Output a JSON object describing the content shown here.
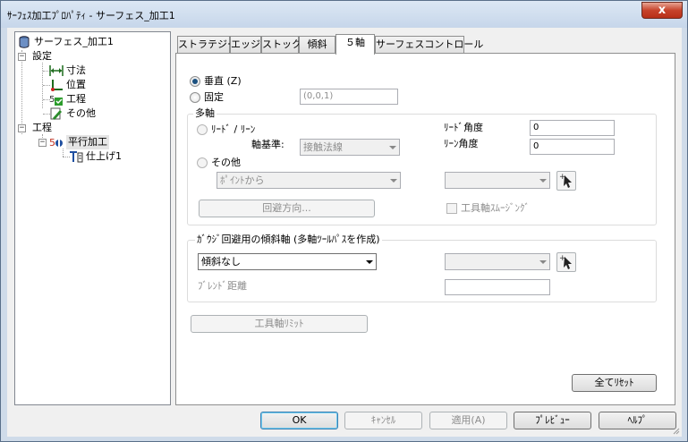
{
  "window": {
    "title": "ｻｰﾌｪｽ加工ﾌﾟﾛﾊﾟﾃｨ - サーフェス_加工1",
    "close_label": "x"
  },
  "tree": {
    "root": "サーフェス_加工1",
    "settings": "設定",
    "settings_items": [
      "寸法",
      "位置",
      "工程",
      "その他"
    ],
    "process": "工程",
    "parallel": "平行加工",
    "finish": "仕上げ1"
  },
  "tabs": [
    "ストラテジー",
    "エッジ",
    "ストック",
    "傾斜",
    "５軸",
    "サーフェスコントロール"
  ],
  "five_axis": {
    "vertical_label": "垂直 (Z)",
    "fixed_label": "固定",
    "fixed_value": "(0,0,1)",
    "multi_axis": {
      "title": "多軸",
      "lead_lean_label": "ﾘｰﾄﾞ / ﾘｰﾝ",
      "axis_ref_label": "軸基準:",
      "axis_ref_value": "接触法線",
      "lead_angle_label": "ﾘｰﾄﾞ角度",
      "lead_angle_value": "0",
      "lean_angle_label": "ﾘｰﾝ角度",
      "lean_angle_value": "0",
      "other_label": "その他",
      "point_from_value": "ﾎﾟｲﾝﾄから",
      "avoid_dir_button": "回避方向...",
      "tool_axis_smoothing_label": "工具軸ｽﾑｰｼﾞﾝｸﾞ"
    },
    "gouge": {
      "title": "ｶﾞｳｼﾞ回避用の傾斜軸 (多軸ﾂｰﾙﾊﾟｽを作成)",
      "tilt_value": "傾斜なし",
      "blend_distance_label": "ﾌﾞﾚﾝﾄﾞ距離"
    },
    "tool_axis_limit_button": "工具軸ﾘﾐｯﾄ",
    "reset_all_button": "全てﾘｾｯﾄ"
  },
  "footer": {
    "ok": "OK",
    "cancel": "ｷｬﾝｾﾙ",
    "apply": "適用(A)",
    "preview": "ﾌﾟﾚﾋﾞｭｰ",
    "help": "ﾍﾙﾌﾟ"
  },
  "colors": {
    "accent": "#1c5180",
    "frame": "#cfdbe9",
    "close": "#c7432b"
  }
}
